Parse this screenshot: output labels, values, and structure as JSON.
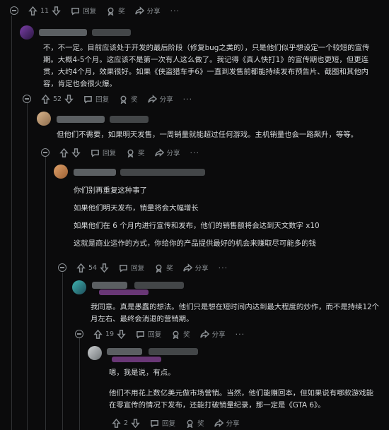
{
  "actions": {
    "reply": "回复",
    "award": "奖",
    "share": "分享",
    "more": "···"
  },
  "comments": [
    {
      "votes": "11"
    },
    {
      "paragraphs": [
        "不，不一定。目前应该处于开发的最后阶段（修复bug之类的），只是他们似乎想设定一个较短的宣传期。大概4-5个月。这应该不是第一次有人这么做了。我记得《真人快打1》的宣传期也更短，但更连贯，大约4个月，效果很好。如果《侠盗猎车手6》一直到发售前都能持续发布预告片、截图和其他内容，肯定也会很火爆。"
      ],
      "votes": "52"
    },
    {
      "paragraphs": [
        "但他们不需要，如果明天发售，一周销量就能超过任何游戏。主机销量也会一路飙升，等等。"
      ]
    },
    {
      "paragraphs": [
        "你们别再重复这种事了",
        "如果他们明天发布，销量将会大幅增长",
        "如果他们在 6 个月内进行宣传和发布，他们的销售额将会达到天文数字 x10",
        "这就是商业运作的方式，你给你的产品提供最好的机会来赚取尽可能多的钱"
      ],
      "votes": "54"
    },
    {
      "paragraphs": [
        "我同意。真是愚蠢的想法。他们只是想在短时间内达到最大程度的炒作，而不是持续12个月左右、最终会消退的营销期。"
      ],
      "votes": "19"
    },
    {
      "paragraphs": [
        "嗯，我是说，有点。",
        "他们不用花上数亿美元做市场营销。当然，他们能赚回本，但如果说有哪款游戏能在零宣传的情况下发布，还能打破销量纪录，那一定是《GTA 6》。"
      ],
      "votes": "2"
    }
  ]
}
